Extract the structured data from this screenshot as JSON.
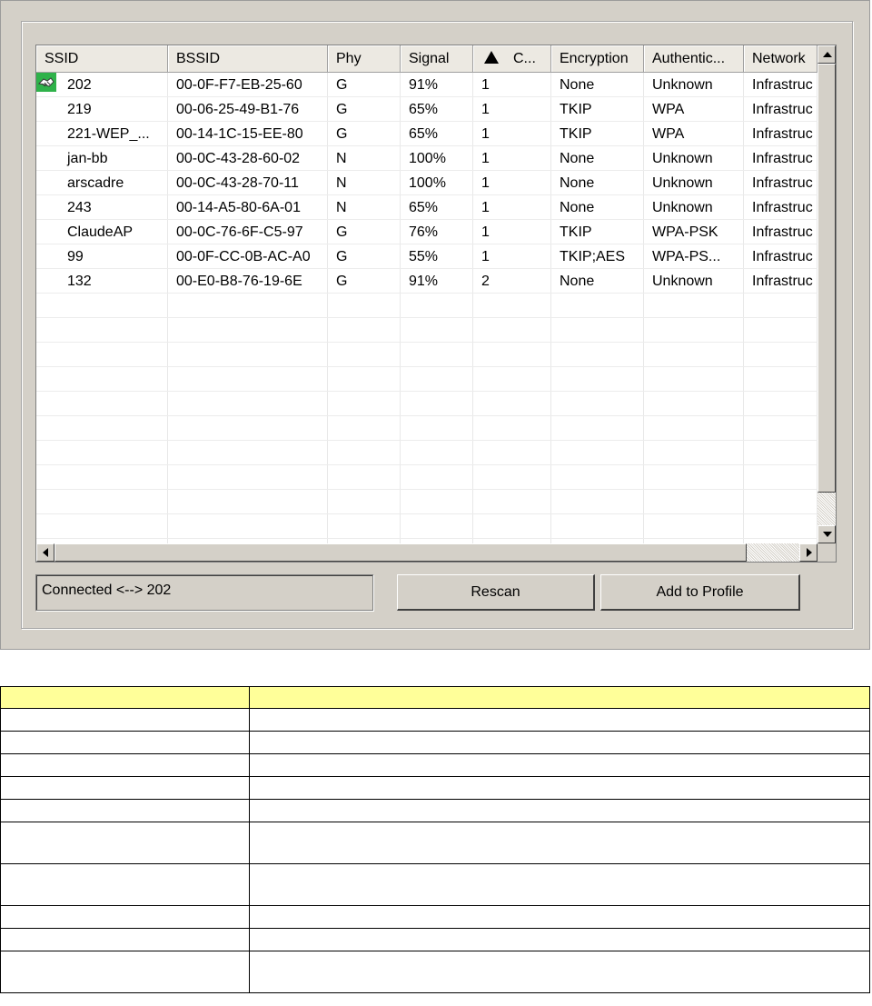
{
  "columns": [
    "SSID",
    "BSSID",
    "Phy",
    "Signal",
    "C...",
    "Encryption",
    "Authentic...",
    "Network"
  ],
  "sorted_column_index": 4,
  "rows": [
    {
      "ssid": "202",
      "bssid": "00-0F-F7-EB-25-60",
      "phy": "G",
      "signal": "91%",
      "channel": "1",
      "encryption": "None",
      "auth": "Unknown",
      "network": "Infrastruc",
      "connected": true
    },
    {
      "ssid": "219",
      "bssid": "00-06-25-49-B1-76",
      "phy": "G",
      "signal": "65%",
      "channel": "1",
      "encryption": "TKIP",
      "auth": "WPA",
      "network": "Infrastruc"
    },
    {
      "ssid": "221-WEP_...",
      "bssid": "00-14-1C-15-EE-80",
      "phy": "G",
      "signal": "65%",
      "channel": "1",
      "encryption": "TKIP",
      "auth": "WPA",
      "network": "Infrastruc"
    },
    {
      "ssid": "jan-bb",
      "bssid": "00-0C-43-28-60-02",
      "phy": "N",
      "signal": "100%",
      "channel": "1",
      "encryption": "None",
      "auth": "Unknown",
      "network": "Infrastruc"
    },
    {
      "ssid": "arscadre",
      "bssid": "00-0C-43-28-70-11",
      "phy": "N",
      "signal": "100%",
      "channel": "1",
      "encryption": "None",
      "auth": "Unknown",
      "network": "Infrastruc"
    },
    {
      "ssid": "243",
      "bssid": "00-14-A5-80-6A-01",
      "phy": "N",
      "signal": "65%",
      "channel": "1",
      "encryption": "None",
      "auth": "Unknown",
      "network": "Infrastruc"
    },
    {
      "ssid": "ClaudeAP",
      "bssid": "00-0C-76-6F-C5-97",
      "phy": "G",
      "signal": "76%",
      "channel": "1",
      "encryption": "TKIP",
      "auth": "WPA-PSK",
      "network": "Infrastruc"
    },
    {
      "ssid": "99",
      "bssid": "00-0F-CC-0B-AC-A0",
      "phy": "G",
      "signal": "55%",
      "channel": "1",
      "encryption": "TKIP;AES",
      "auth": "WPA-PS...",
      "network": "Infrastruc"
    },
    {
      "ssid": "132",
      "bssid": "00-E0-B8-76-19-6E",
      "phy": "G",
      "signal": "91%",
      "channel": "2",
      "encryption": "None",
      "auth": "Unknown",
      "network": "Infrastruc"
    }
  ],
  "status_text": "Connected <--> 202",
  "buttons": {
    "rescan": "Rescan",
    "add_to_profile": "Add to Profile"
  },
  "icons": {
    "connected": "connected-network-icon",
    "sort": "sort-ascending-icon"
  },
  "colors": {
    "dialog_bg": "#d4d0c8",
    "table_header_bg": "#ffff99",
    "icon_green": "#2fb24a"
  }
}
